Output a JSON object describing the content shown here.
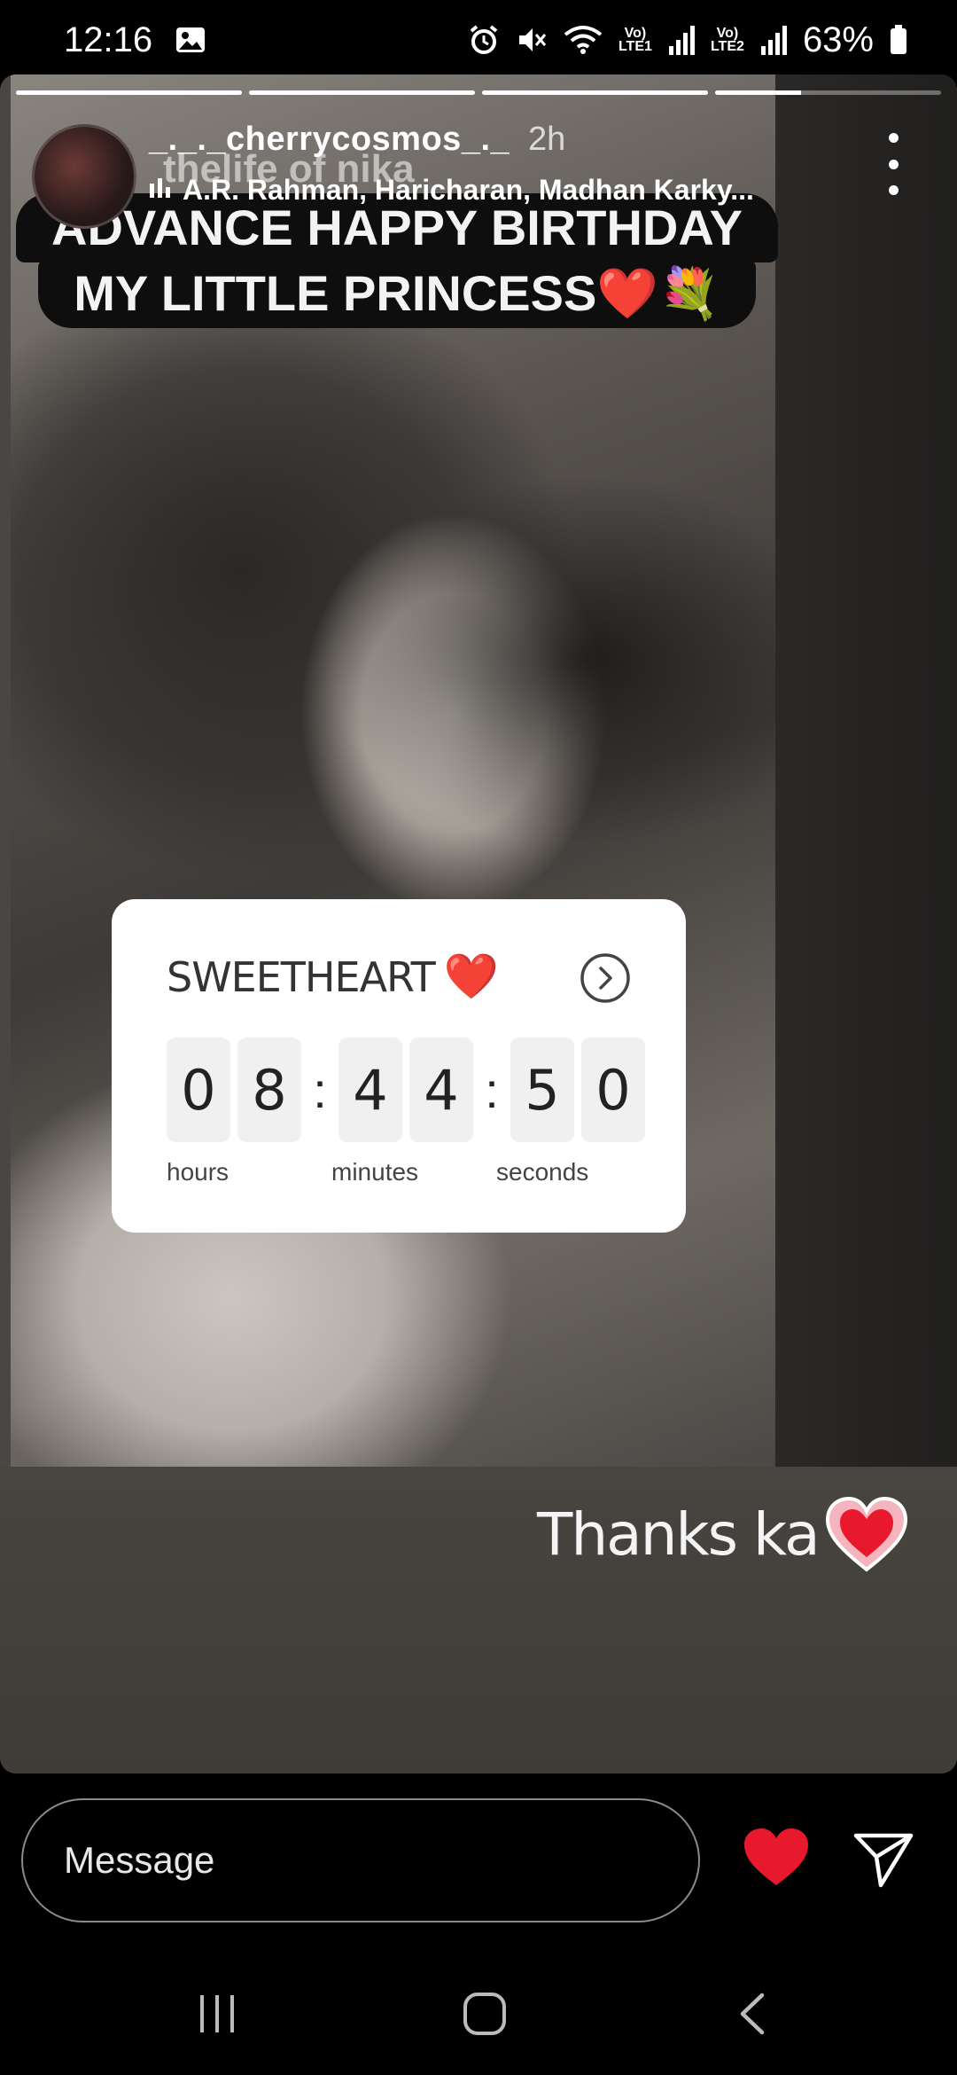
{
  "status_bar": {
    "time": "12:16",
    "sim1": "Vo) LTE1",
    "sim2": "Vo) LTE2",
    "battery": "63%"
  },
  "story": {
    "progress": [
      1,
      1,
      1,
      0.38
    ],
    "username": "_._._cherrycosmos_._",
    "time_ago": "2h",
    "music": "A.R. Rahman, Haricharan, Madhan Karky...",
    "faded_caption": "thelife of nika",
    "caption_line1": "ADVANCE HAPPY BIRTHDAY",
    "caption_line2": "MY LITTLE PRINCESS❤️💐",
    "countdown": {
      "title": "SWEETHEART",
      "heart": "❤️",
      "digits": [
        "0",
        "8",
        "4",
        "4",
        "5",
        "0"
      ],
      "labels": {
        "hours": "hours",
        "minutes": "minutes",
        "seconds": "seconds"
      }
    },
    "reply_text": "Thanks ka"
  },
  "reply_bar": {
    "placeholder": "Message"
  },
  "colors": {
    "like": "#e8192c",
    "story_bg": "#4a4643",
    "sticker_bg": "#ffffff"
  },
  "icons": {
    "gallery": "image-icon",
    "alarm": "alarm-icon",
    "mute": "mute-icon",
    "wifi": "wifi-icon",
    "signal": "signal-icon",
    "battery": "battery-icon",
    "more": "more-vertical-icon",
    "music": "music-bars-icon",
    "arrow": "chevron-right-circle-icon",
    "like": "heart-icon",
    "send": "send-icon",
    "recents": "recents-icon",
    "home": "home-icon",
    "back": "back-icon"
  }
}
